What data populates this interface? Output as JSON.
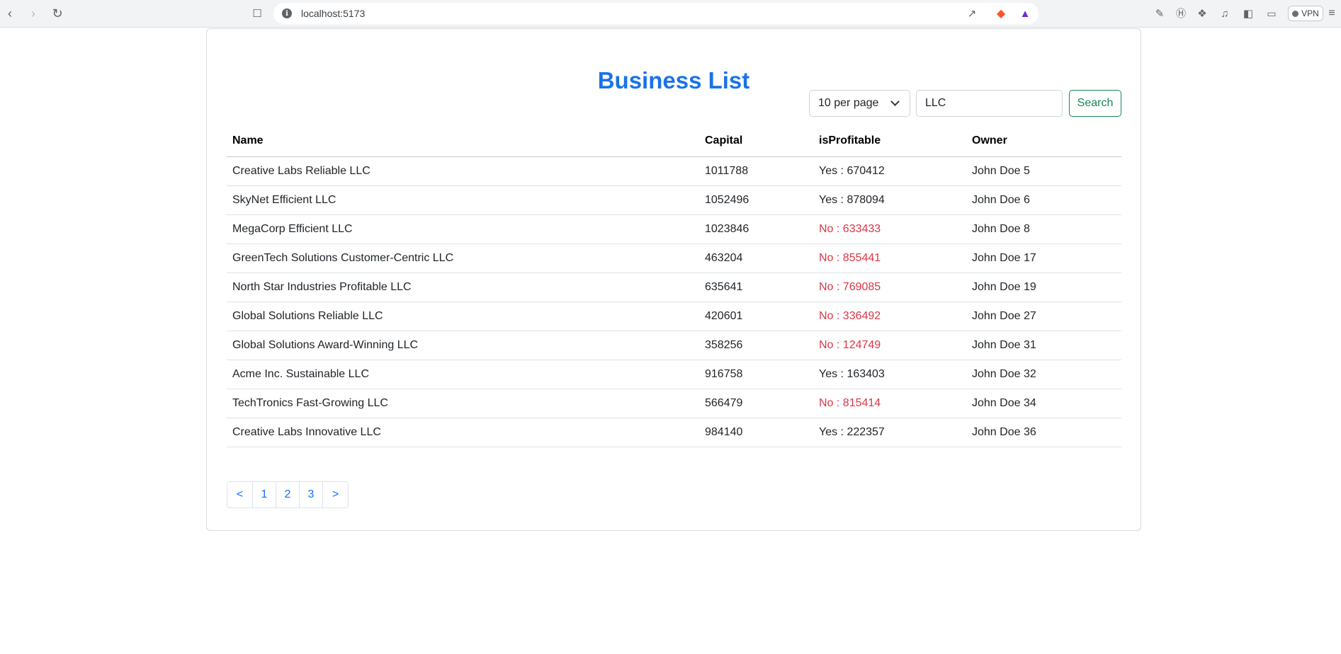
{
  "browser": {
    "url": "localhost:5173",
    "vpn_label": "VPN"
  },
  "page": {
    "title": "Business List",
    "per_page_select": "10 per page",
    "search_value": "LLC",
    "search_button": "Search"
  },
  "table": {
    "headers": [
      "Name",
      "Capital",
      "isProfitable",
      "Owner"
    ],
    "rows": [
      {
        "name": "Creative Labs Reliable LLC",
        "capital": "1011788",
        "profitable": "Yes : 670412",
        "owner": "John Doe 5"
      },
      {
        "name": "SkyNet Efficient LLC",
        "capital": "1052496",
        "profitable": "Yes : 878094",
        "owner": "John Doe 6"
      },
      {
        "name": "MegaCorp Efficient LLC",
        "capital": "1023846",
        "profitable": "No : 633433",
        "owner": "John Doe 8"
      },
      {
        "name": "GreenTech Solutions Customer-Centric LLC",
        "capital": "463204",
        "profitable": "No : 855441",
        "owner": "John Doe 17"
      },
      {
        "name": "North Star Industries Profitable LLC",
        "capital": "635641",
        "profitable": "No : 769085",
        "owner": "John Doe 19"
      },
      {
        "name": "Global Solutions Reliable LLC",
        "capital": "420601",
        "profitable": "No : 336492",
        "owner": "John Doe 27"
      },
      {
        "name": "Global Solutions Award-Winning LLC",
        "capital": "358256",
        "profitable": "No : 124749",
        "owner": "John Doe 31"
      },
      {
        "name": "Acme Inc. Sustainable LLC",
        "capital": "916758",
        "profitable": "Yes : 163403",
        "owner": "John Doe 32"
      },
      {
        "name": "TechTronics Fast-Growing LLC",
        "capital": "566479",
        "profitable": "No : 815414",
        "owner": "John Doe 34"
      },
      {
        "name": "Creative Labs Innovative LLC",
        "capital": "984140",
        "profitable": "Yes : 222357",
        "owner": "John Doe 36"
      }
    ]
  },
  "pagination": {
    "prev": "<",
    "pages": [
      "1",
      "2",
      "3"
    ],
    "next": ">"
  },
  "colors": {
    "title": "#1a73e8",
    "negative": "#dc3545",
    "search_button": "#198754"
  }
}
